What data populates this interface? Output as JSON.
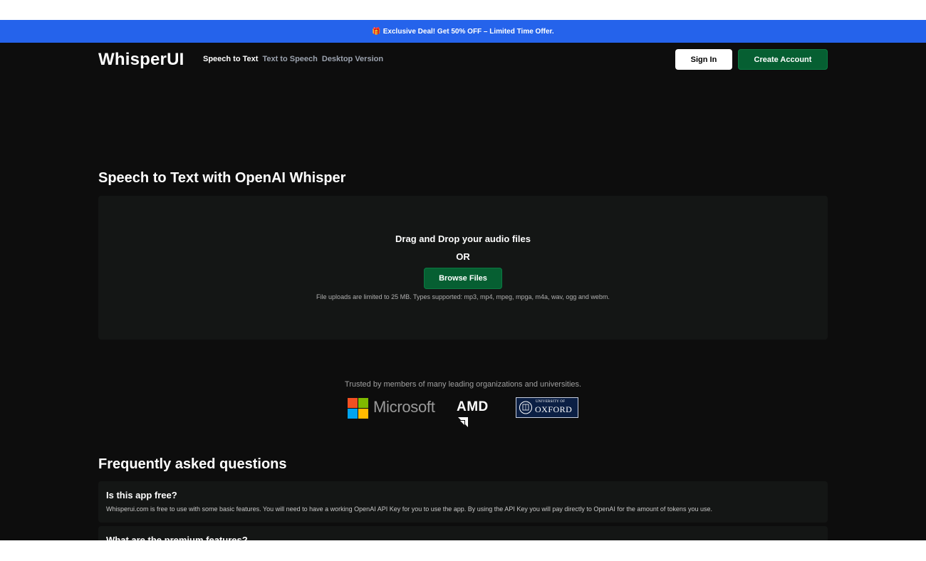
{
  "banner": {
    "gift_icon": "gift-icon",
    "text": "Exclusive Deal! Get 50% OFF – Limited Time Offer.",
    "color": "#2563eb"
  },
  "nav": {
    "logo": "WhisperUI",
    "links": [
      "Speech to Text",
      "Text to Speech",
      "Desktop Version"
    ],
    "sign_in": "Sign In",
    "create_account": "Create Account"
  },
  "main": {
    "title": "Speech to Text with OpenAI Whisper",
    "drop_zone": {
      "line1": "Drag and Drop your audio files",
      "line2": "OR",
      "browse_label": "Browse Files",
      "note": "File uploads are limited to 25 MB. Types supported: mp3, mp4, mpeg, mpga, m4a, wav, ogg and webm."
    }
  },
  "trusted": {
    "text": "Trusted by members of many leading organizations and universities.",
    "logos": {
      "microsoft": "Microsoft",
      "amd": "AMD",
      "oxford_top": "UNIVERSITY OF",
      "oxford_name": "OXFORD"
    }
  },
  "faq": {
    "title": "Frequently asked questions",
    "items": [
      {
        "q": "Is this app free?",
        "a": "Whisperui.com is free to use with some basic features. You will need to have a working OpenAI API Key for you to use the app. By using the API Key you will pay directly to OpenAI for the amount of tokens you use."
      },
      {
        "q": "What are the premium features?",
        "a": ""
      }
    ]
  },
  "colors": {
    "accent_green": "#065f32",
    "background": "#0d0d0d",
    "card": "#141615"
  }
}
